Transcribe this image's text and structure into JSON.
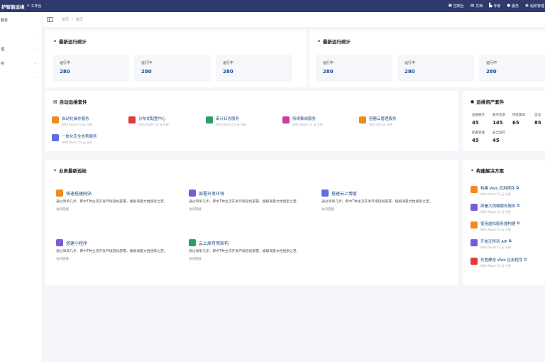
{
  "topbar": {
    "brand": "护智能运维",
    "workbench": "工作台",
    "items": [
      {
        "icon": "monitor-icon",
        "label": "控制台"
      },
      {
        "icon": "document-icon",
        "label": "文档"
      },
      {
        "icon": "chart-icon",
        "label": "专家"
      },
      {
        "icon": "user-icon",
        "label": "服务"
      },
      {
        "icon": "help-icon",
        "label": "组织管理"
      }
    ]
  },
  "sidebar": {
    "items": [
      "服务",
      "",
      "理",
      "控",
      ""
    ]
  },
  "breadcrumb": {
    "home": "首页",
    "sep": "/",
    "current": "首页"
  },
  "stats_left": {
    "title": "最新运行统计",
    "boxes": [
      {
        "label": "运行中",
        "value": "280"
      },
      {
        "label": "运行中",
        "value": "280"
      },
      {
        "label": "运行中",
        "value": "280"
      }
    ]
  },
  "stats_right": {
    "title": "最新运行统计",
    "boxes": [
      {
        "label": "运行中",
        "value": "280"
      },
      {
        "label": "运行中",
        "value": "280"
      },
      {
        "label": "运行中",
        "value": "280"
      }
    ]
  },
  "ops": {
    "title": "自动运维套件",
    "items": [
      {
        "name": "自动化操作服务",
        "sub": "With Route 53 云 分钟",
        "color": "#f08a24"
      },
      {
        "name": "分布式配置中心",
        "sub": "With Route 53 云 分钟",
        "color": "#e23b3b"
      },
      {
        "name": "审计日志服务",
        "sub": "With Route 53 云 分钟",
        "color": "#2a9d6a"
      },
      {
        "name": "持续集成服务",
        "sub": "With Route 53 云 分钟",
        "color": "#c73fa6"
      },
      {
        "name": "容器云管理服务",
        "sub": "With EC2 云 分钟",
        "color": "#f08a24"
      },
      {
        "name": "一体化安全态势服务",
        "sub": "With Route 53 云 分钟",
        "color": "#5b6ee1"
      }
    ]
  },
  "assets": {
    "title": "运维资产套件",
    "items": [
      {
        "label": "运维服务",
        "value": "45"
      },
      {
        "label": "服务资源",
        "value": "145"
      },
      {
        "label": "持续集成",
        "value": "65"
      },
      {
        "label": "自动",
        "value": "85"
      },
      {
        "label": "配置管理",
        "value": "45"
      },
      {
        "label": "安全监控",
        "value": "45"
      }
    ]
  },
  "business": {
    "title": "业务最新巡检",
    "items": [
      {
        "title": "快速搭建网站",
        "desc": "通过简单几步，即中T种主流开发环境轻松部署，缓解海量文档搜索之苦。",
        "link": "访问链接",
        "color": "#f08a24"
      },
      {
        "title": "部署开发环境",
        "desc": "通过简单几步，即中T种主流开发环境轻松部署，缓解海量文档搜索之苦。",
        "link": "访问链接",
        "color": "#7a5bd6"
      },
      {
        "title": "搭建云上博客",
        "desc": "通过简单几步，即中T种主流开发环境轻松部署，缓解海量文档搜索之苦。",
        "link": "访问链接",
        "color": "#5b6ee1"
      },
      {
        "title": "搭建小程序",
        "desc": "通过简单几步，即中T种主流开发环境轻松部署，缓解海量文档搜索之苦。",
        "link": "访问链接",
        "color": "#7a5bd6"
      },
      {
        "title": "云上高可用架构",
        "desc": "通过简单几步，即中T种主流开发环境轻松部署，缓解海量文档搜索之苦。",
        "link": "访问链接",
        "color": "#2a9d6a"
      }
    ]
  },
  "solutions": {
    "title": "构建解决方案",
    "items": [
      {
        "name": "构建 Web 应用程序",
        "sub": "With Route 53 云 分钟",
        "color": "#f08a24"
      },
      {
        "name": "部署大规模服务服务",
        "sub": "With Route 53 云 分钟",
        "color": "#7a5bd6"
      },
      {
        "name": "使用虚拟服务器构建",
        "sub": "With Route 53 云 分钟",
        "color": "#f08a24"
      },
      {
        "name": "开始迁移到 AIP",
        "sub": "With Route 53 云 分钟",
        "color": "#7a5bd6"
      },
      {
        "name": "托管静态 Web 应用程序",
        "sub": "With Route 53 云 分钟",
        "color": "#e23b3b"
      }
    ]
  }
}
